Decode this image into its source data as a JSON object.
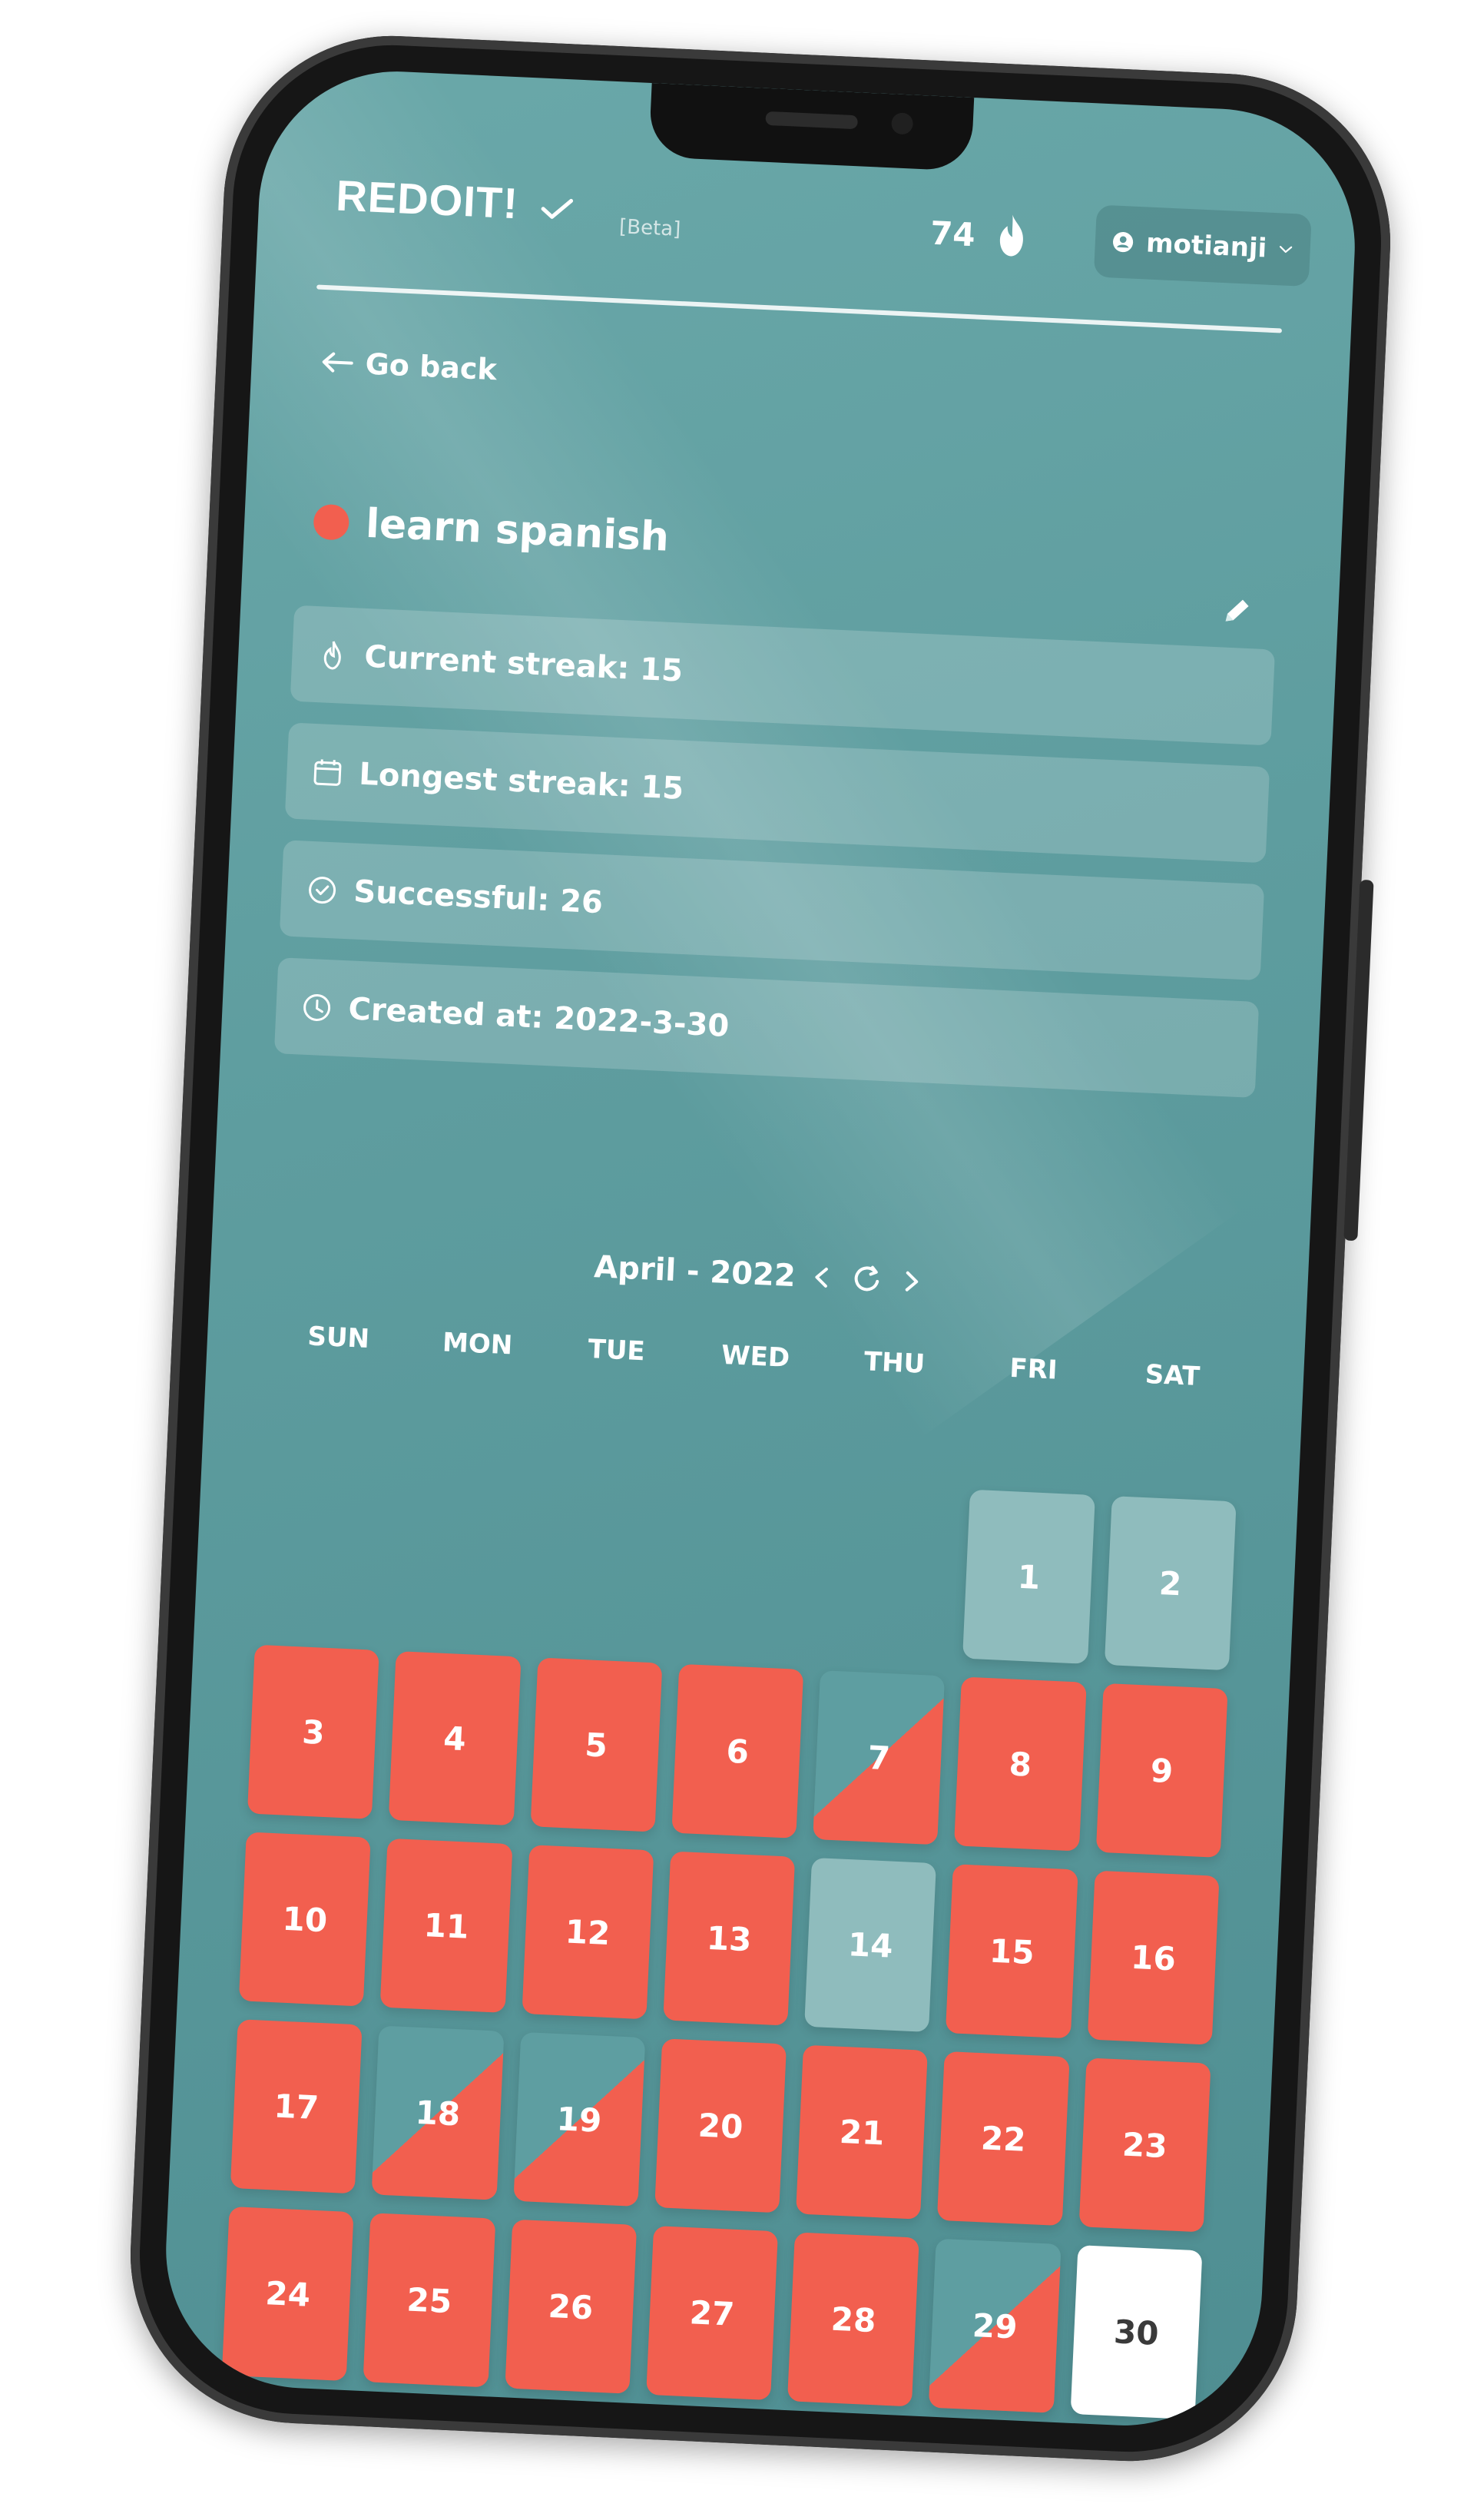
{
  "app": {
    "brand": "REDOIT!",
    "beta": "[Beta]",
    "score": "74",
    "user": "motianji"
  },
  "navigation": {
    "go_back": "Go back"
  },
  "habit": {
    "title": "learn spanish",
    "accent": "#f25f4f"
  },
  "stats": {
    "current": "Current streak: 15",
    "longest": "Longest streak: 15",
    "successful": "Successful: 26",
    "created": "Created at: 2022-3-30"
  },
  "calendar": {
    "month_label": "April - 2022",
    "weekdays": [
      "SUN",
      "MON",
      "TUE",
      "WED",
      "THU",
      "FRI",
      "SAT"
    ],
    "days": [
      "1",
      "2",
      "3",
      "4",
      "5",
      "6",
      "7",
      "8",
      "9",
      "10",
      "11",
      "12",
      "13",
      "14",
      "15",
      "16",
      "17",
      "18",
      "19",
      "20",
      "21",
      "22",
      "23",
      "24",
      "25",
      "26",
      "27",
      "28",
      "29",
      "30"
    ],
    "status_colors": {
      "done": "#f25f4f",
      "missed": "#8fbcbd",
      "partial": "#5e9ea1",
      "today": "#ffffff"
    }
  }
}
